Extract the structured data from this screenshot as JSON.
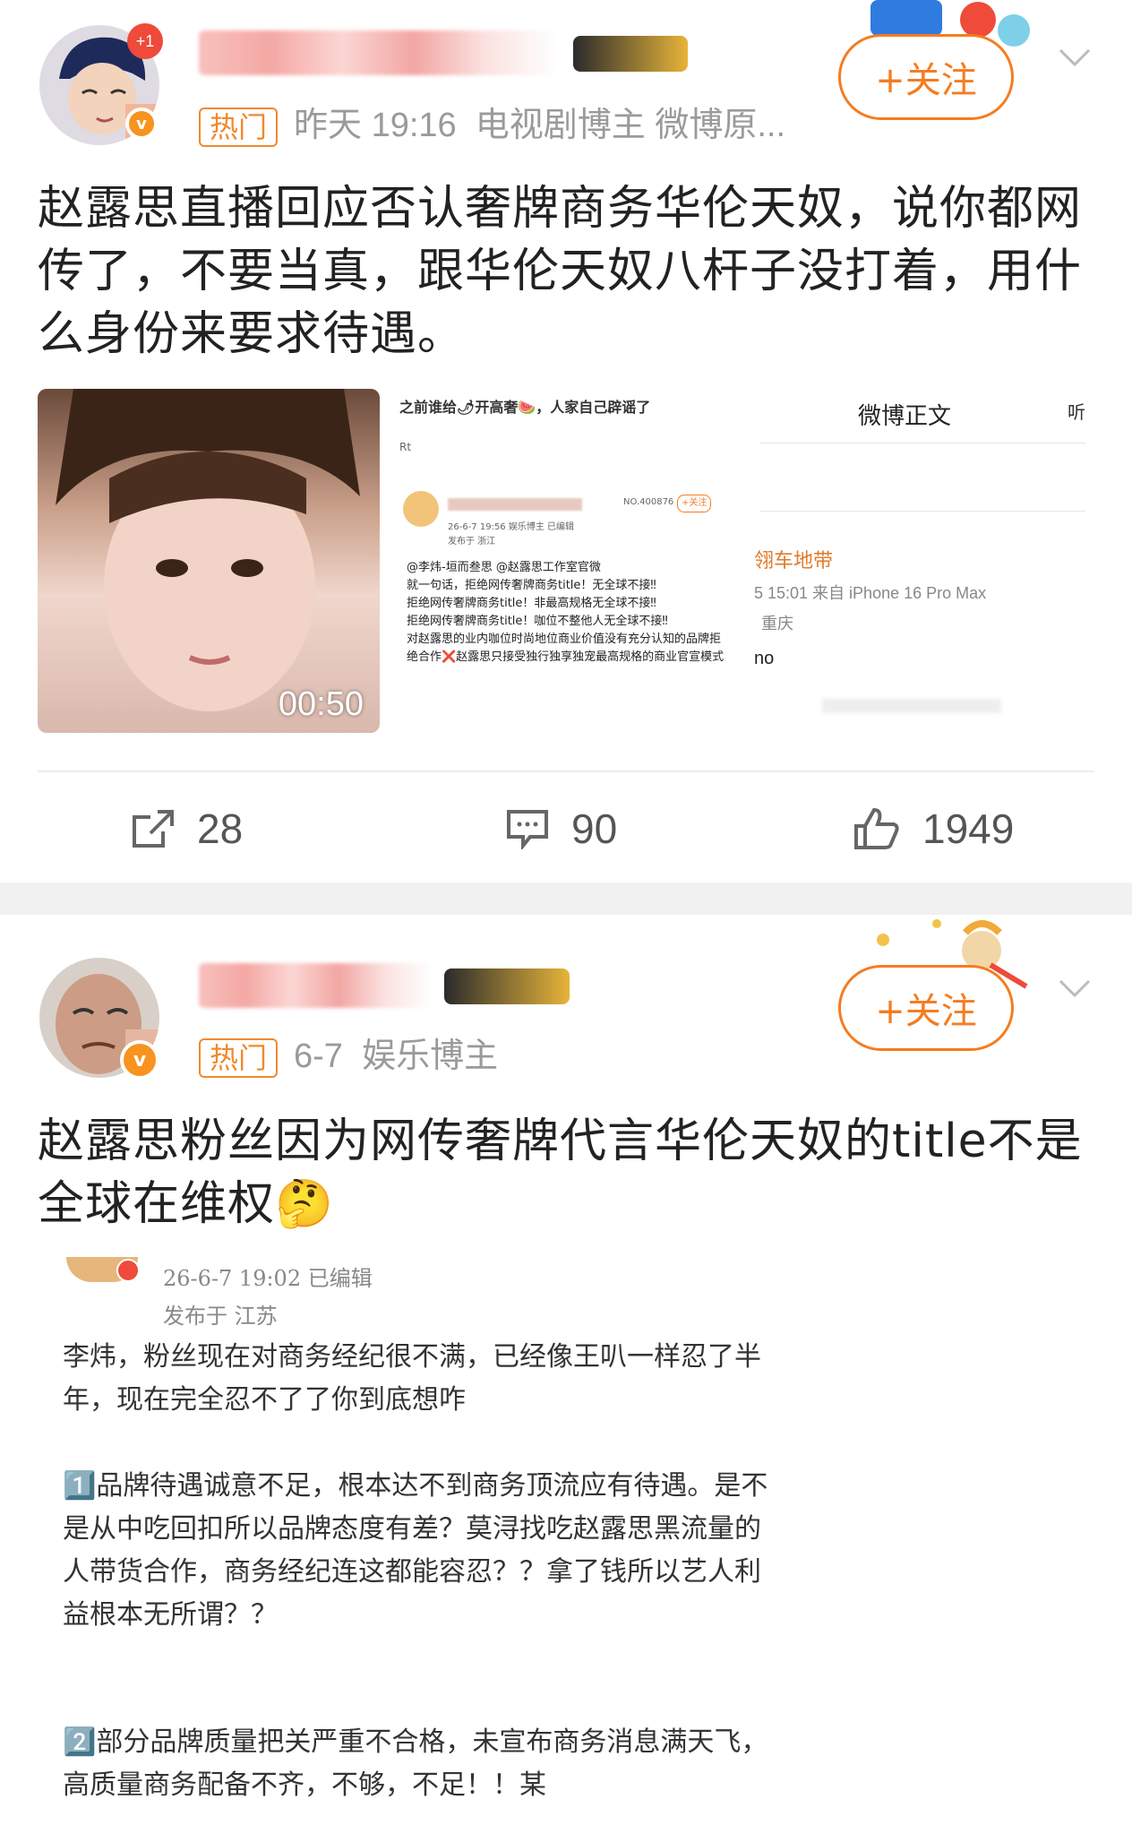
{
  "post1": {
    "hot_label": "热门",
    "time": "昨天 19:16",
    "author_tags": "电视剧博主 微博原...",
    "follow_label": "+关注",
    "text": "赵露思直播回应否认奢牌商务华伦天奴，说你都网传了，不要当真，跟华伦天奴八杆子没打着，用什么身份来要求待遇。",
    "video_duration": "00:50",
    "screenshot_a": {
      "caption": "之前谁给🌶开高奢🍉，人家自己辟谣了",
      "rt": "Rt",
      "inner_meta": "26-6-7 19:56  娱乐博主  已编辑",
      "inner_location": "发布于 浙江",
      "inner_follow": "+关注",
      "inner_no": "NO.400876",
      "body": "@李炜-垣而叁思 @赵露思工作室官微\n就一句话，拒绝网传奢牌商务title！无全球不接‼\n拒绝网传奢牌商务title！非最高规格无全球不接‼\n拒绝网传奢牌商务title！咖位不整他人无全球不接‼\n对赵露思的业内咖位时尚地位商业价值没有充分认知的品牌拒绝合作❌赵露思只接受独行独享独宠最高规格的商业官宣模式"
    },
    "screenshot_b": {
      "header": "微博正文",
      "listen_label": "听",
      "name_fragment": "翎车地带",
      "time_fragment": "5 15:01  来自 iPhone 16 Pro Max",
      "location_fragment": "重庆",
      "text_fragment": "no"
    },
    "repost_count": "28",
    "comment_count": "90",
    "like_count": "1949"
  },
  "post2": {
    "hot_label": "热门",
    "time": "6-7",
    "author_tags": "娱乐博主",
    "follow_label": "+关注",
    "text": "赵露思粉丝因为网传奢牌代言华伦天奴的title不是全球在维权🤔",
    "quote": {
      "meta": "26-6-7 19:02  已编辑",
      "location": "发布于 江苏",
      "p1": "李炜，粉丝现在对商务经纪很不满，已经像王叭一样忍了半年，现在完全忍不了了你到底想咋",
      "p2": "1️⃣品牌待遇诚意不足，根本达不到商务顶流应有待遇。是不是从中吃回扣所以品牌态度有差？莫浔找吃赵露思黑流量的人带货合作，商务经纪连这都能容忍？？拿了钱所以艺人利益根本无所谓？？",
      "p3": "2️⃣部分品牌质量把关严重不合格，未宣布商务消息满天飞，高质量商务配备不齐，不够，不足！！某"
    }
  },
  "colors": {
    "accent": "#f57c21",
    "hot": "#ef8a2c",
    "meta": "#9a9a9a",
    "separator": "#f1f1f1"
  }
}
